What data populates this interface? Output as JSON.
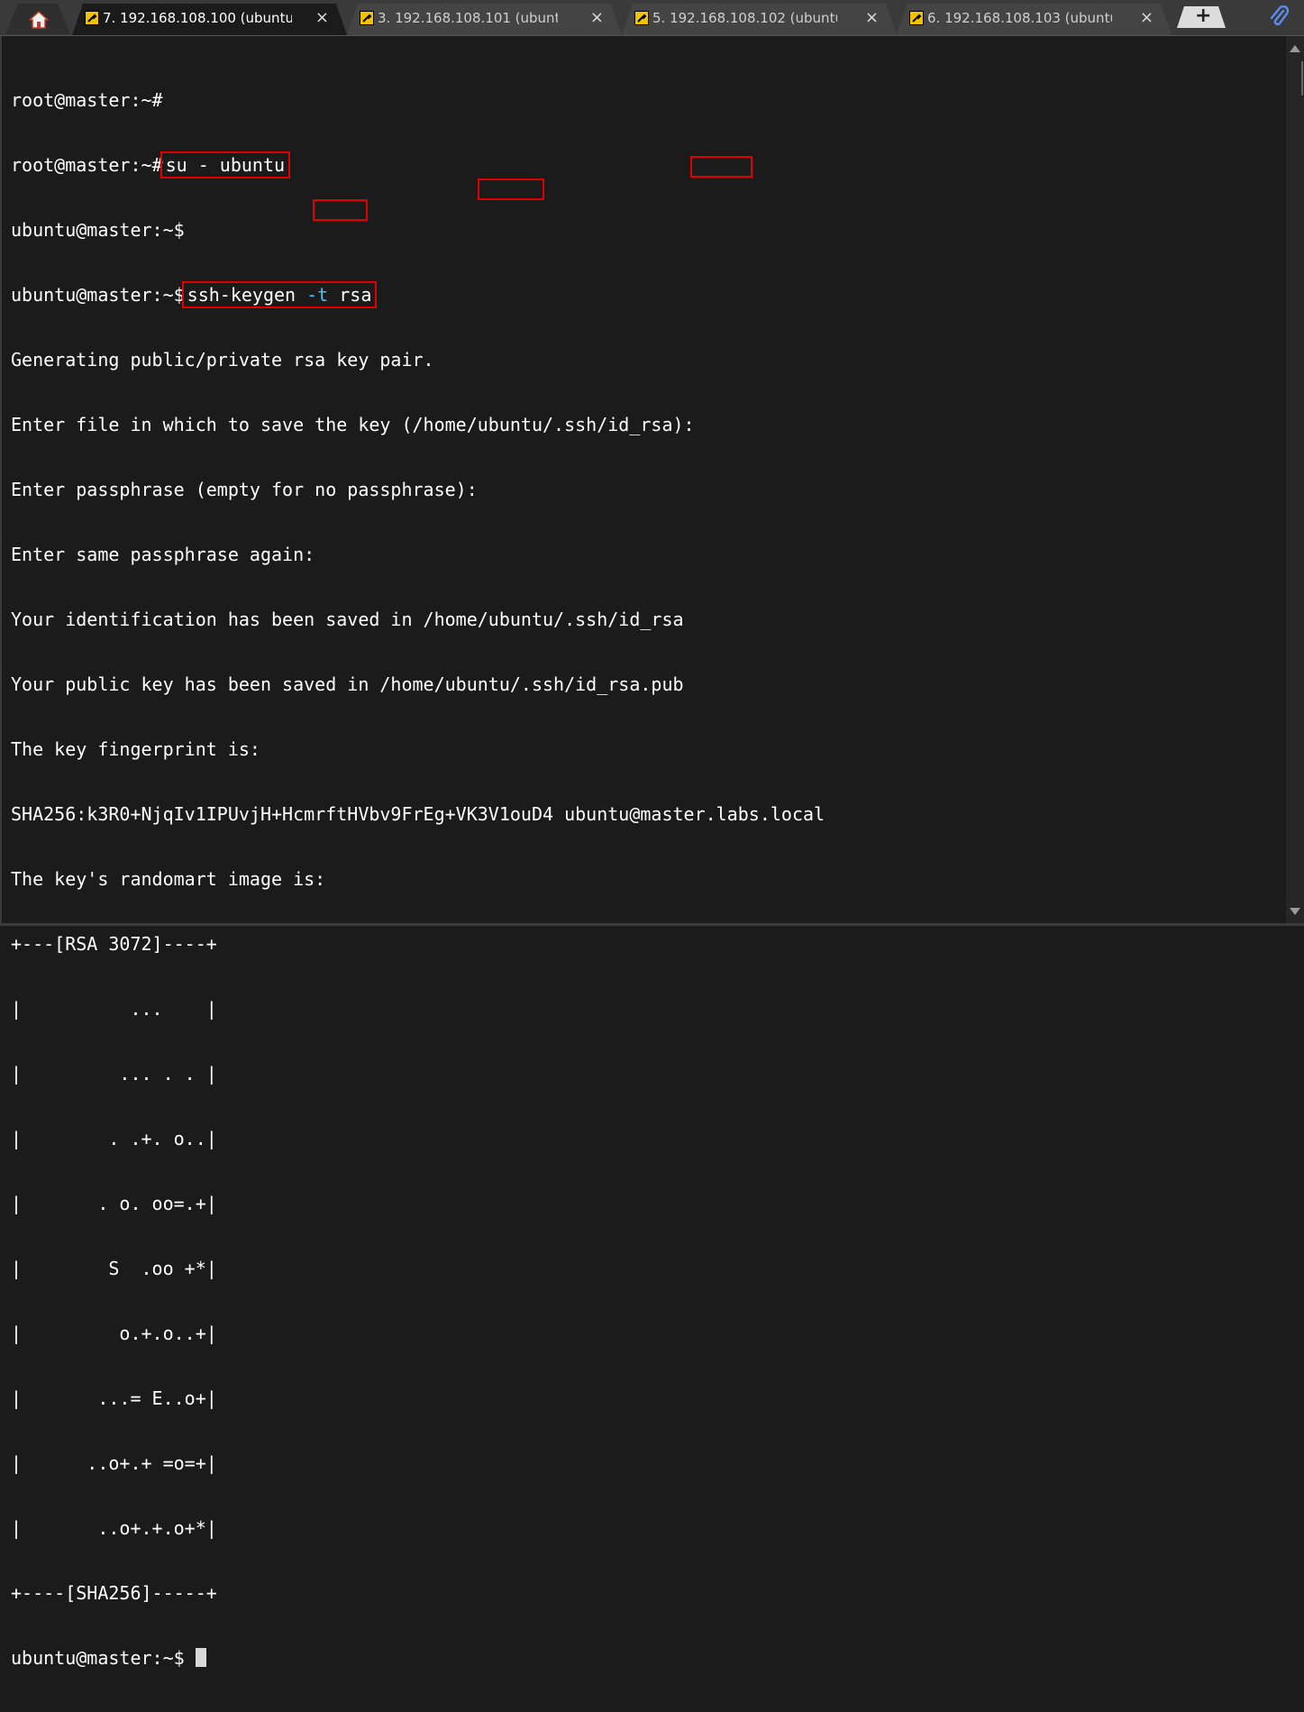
{
  "tabs": [
    {
      "label": "7. 192.168.108.100 (ubuntu)",
      "active": true
    },
    {
      "label": "3. 192.168.108.101 (ubuntu)",
      "active": false
    },
    {
      "label": "5. 192.168.108.102 (ubuntu)",
      "active": false
    },
    {
      "label": "6. 192.168.108.103 (ubuntu)",
      "active": false
    }
  ],
  "tab_close_glyph": "×",
  "new_tab_glyph": "+",
  "colors": {
    "highlight_box": "#e00000",
    "terminal_bg": "#1b1b1b",
    "terminal_fg": "#ffffff",
    "flag_color": "#4fc3f7",
    "tab_icon": "#f2c200"
  },
  "icons": {
    "home": "home-icon",
    "tab": "wrench-icon",
    "new_tab": "plus-icon",
    "attach": "paperclip-icon"
  },
  "terminal": {
    "lines": [
      "root@master:~#",
      "root@master:~#",
      "ubuntu@master:~$",
      "ubuntu@master:~$",
      "Generating public/private rsa key pair.",
      "Enter file in which to save the key (/home/ubuntu/.ssh/id_rsa):",
      "Enter passphrase (empty for no passphrase):",
      "Enter same passphrase again:",
      "Your identification has been saved in /home/ubuntu/.ssh/id_rsa",
      "Your public key has been saved in /home/ubuntu/.ssh/id_rsa.pub",
      "The key fingerprint is:",
      "SHA256:k3R0+NjqIv1IPUvjH+HcmrftHVbv9FrEg+VK3V1ouD4 ubuntu@master.labs.local",
      "The key's randomart image is:",
      "+---[RSA 3072]----+",
      "|          ...    |",
      "|         ... . . |",
      "|        . .+. o..|",
      "|       . o. oo=.+|",
      "|        S  .oo +*|",
      "|         o.+.o..+|",
      "|       ...= E..o+|",
      "|      ..o+.+ =o=+|",
      "|       ..o+.+.o+*|",
      "+----[SHA256]-----+",
      "ubuntu@master:~$"
    ],
    "commands": {
      "su": "su - ubuntu",
      "keygen_cmd": "ssh-keygen",
      "keygen_flag": "-t",
      "keygen_arg": "rsa"
    }
  }
}
